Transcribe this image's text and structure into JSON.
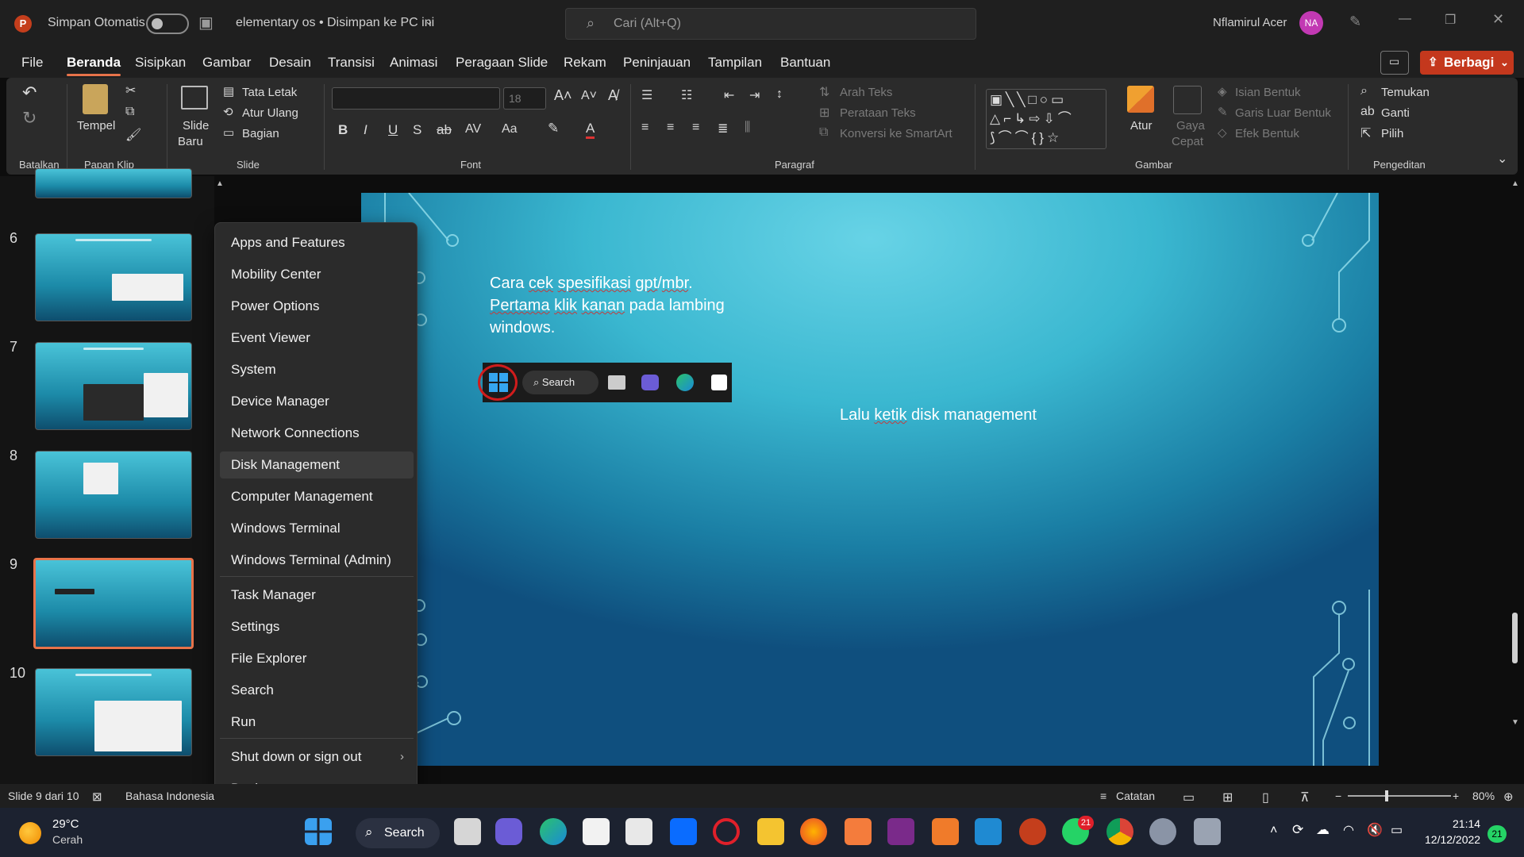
{
  "titlebar": {
    "autosave_label": "Simpan Otomatis",
    "doc_title": "elementary os  •  Disimpan ke PC ini",
    "search_placeholder": "Cari (Alt+Q)",
    "user_name": "Nflamirul Acer",
    "user_initials": "NA"
  },
  "menubar": {
    "tabs": [
      "File",
      "Beranda",
      "Sisipkan",
      "Gambar",
      "Desain",
      "Transisi",
      "Animasi",
      "Peragaan Slide",
      "Rekam",
      "Peninjauan",
      "Tampilan",
      "Bantuan"
    ],
    "active_tab": "Beranda",
    "share_label": "Berbagi"
  },
  "ribbon": {
    "groups": {
      "undo": "Batalkan",
      "clipboard": "Papan Klip",
      "slide": "Slide",
      "font": "Font",
      "paragraph": "Paragraf",
      "drawing": "Gambar",
      "editing": "Pengeditan"
    },
    "paste_label": "Tempel",
    "new_slide_label1": "Slide",
    "new_slide_label2": "Baru",
    "layout_label": "Tata Letak",
    "reset_label": "Atur Ulang",
    "section_label": "Bagian",
    "font_size": "18",
    "text_direction": "Arah Teks",
    "align_text": "Perataan Teks",
    "smartart": "Konversi ke SmartArt",
    "arrange_label": "Atur",
    "quick_styles1": "Gaya",
    "quick_styles2": "Cepat",
    "shape_fill": "Isian Bentuk",
    "shape_outline": "Garis Luar Bentuk",
    "shape_effects": "Efek Bentuk",
    "find_label": "Temukan",
    "replace_label": "Ganti",
    "select_label": "Pilih"
  },
  "thumbnails": {
    "numbers": [
      "6",
      "7",
      "8",
      "9",
      "10"
    ],
    "selected": "9"
  },
  "slide": {
    "caption1_a": "Cara ",
    "caption1_b": "cek",
    "caption1_c": " ",
    "caption1_d": "spesifikasi",
    "caption1_e": " ",
    "caption1_f": "gpt",
    "caption1_g": "/",
    "caption1_h": "mbr",
    "caption1_i": ".",
    "caption2_a": "Pertama",
    "caption2_b": " ",
    "caption2_c": "klik",
    "caption2_d": " ",
    "caption2_e": "kanan",
    "caption2_f": " pada lambing windows.",
    "caption3_a": "Lalu ",
    "caption3_b": "ketik",
    "caption3_c": " disk management",
    "taskbar_search": "Search"
  },
  "context_menu": {
    "items": [
      "Apps and Features",
      "Mobility Center",
      "Power Options",
      "Event Viewer",
      "System",
      "Device Manager",
      "Network Connections",
      "Disk Management",
      "Computer Management",
      "Windows Terminal",
      "Windows Terminal (Admin)",
      "Task Manager",
      "Settings",
      "File Explorer",
      "Search",
      "Run",
      "Shut down or sign out",
      "Desktop"
    ],
    "highlighted": "Disk Management"
  },
  "statusbar": {
    "slide_info": "Slide 9 dari 10",
    "language": "Bahasa Indonesia",
    "notes": "Catatan",
    "zoom": "80%"
  },
  "taskbar": {
    "weather_temp": "29°C",
    "weather_desc": "Cerah",
    "search_label": "Search",
    "time": "21:14",
    "date": "12/12/2022",
    "whatsapp_badge": "21",
    "notif_badge": "21"
  },
  "colors": {
    "accent": "#e8734a",
    "share": "#c4381d",
    "avatar": "#c239b3"
  }
}
